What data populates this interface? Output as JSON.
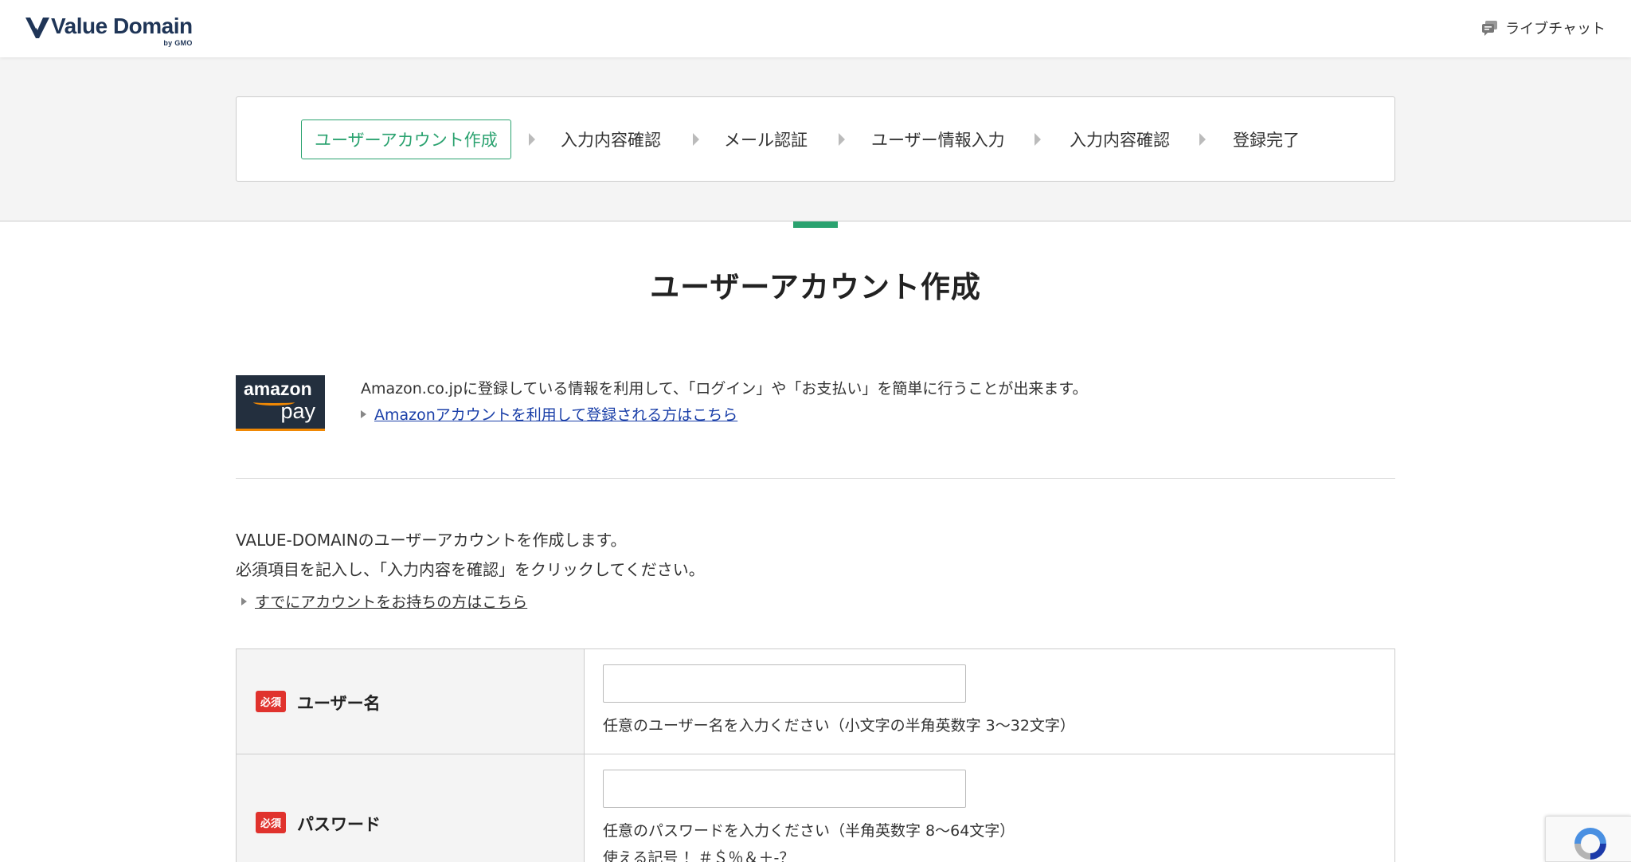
{
  "header": {
    "logo_text": "Value Domain",
    "logo_by": "by GMO",
    "livechat_label": "ライブチャット"
  },
  "steps": [
    {
      "label": "ユーザーアカウント作成",
      "active": true
    },
    {
      "label": "入力内容確認",
      "active": false
    },
    {
      "label": "メール認証",
      "active": false
    },
    {
      "label": "ユーザー情報入力",
      "active": false
    },
    {
      "label": "入力内容確認",
      "active": false
    },
    {
      "label": "登録完了",
      "active": false
    }
  ],
  "page_title": "ユーザーアカウント作成",
  "amazon": {
    "logo_line1": "amazon",
    "logo_line2": "pay",
    "description": "Amazon.co.jpに登録している情報を利用して、「ログイン」や「お支払い」を簡単に行うことが出来ます。",
    "link_label": "Amazonアカウントを利用して登録される方はこちら"
  },
  "intro": {
    "line1": "VALUE-DOMAINのユーザーアカウントを作成します。",
    "line2": "必須項目を記入し、「入力内容を確認」をクリックしてください。",
    "existing_link": "すでにアカウントをお持ちの方はこちら"
  },
  "form": {
    "required_badge": "必須",
    "username": {
      "label": "ユーザー名",
      "value": "",
      "hint": "任意のユーザー名を入力ください（小文字の半角英数字 3〜32文字）"
    },
    "password": {
      "label": "パスワード",
      "value": "",
      "hint": "任意のパスワードを入力ください（半角英数字 8〜64文字）",
      "hint2": "使える記号 ！＃＄％＆＋-？"
    }
  },
  "colors": {
    "accent": "#2aa26f",
    "brand": "#1f3557",
    "required": "#e0322d",
    "link": "#1a3fa8"
  }
}
